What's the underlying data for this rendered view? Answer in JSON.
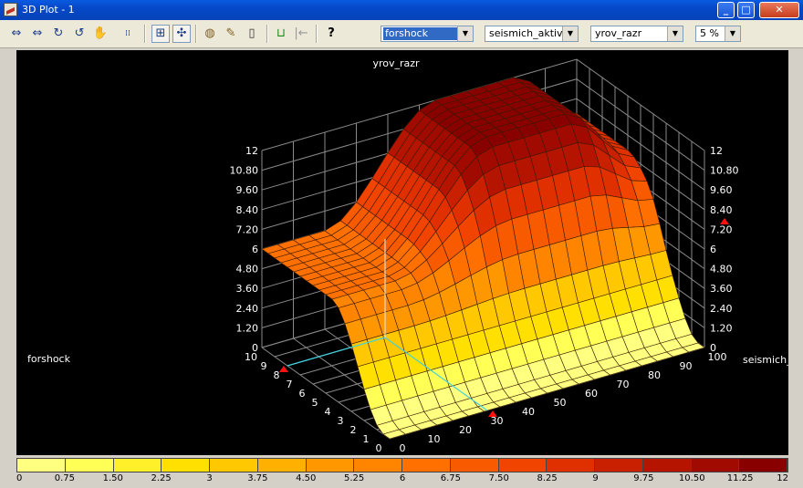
{
  "window": {
    "title": "3D Plot - 1",
    "min": "_",
    "max": "□",
    "close": "✕"
  },
  "toolbar": {
    "combo_x": "forshock",
    "combo_y": "seismich_aktivn",
    "combo_z": "yrov_razr",
    "combo_pct": "5 %"
  },
  "plot": {
    "z_title": "yrov_razr",
    "x_axis_label": "forshock",
    "y_axis_label": "seismich_a",
    "z_ticks": [
      "0",
      "1.20",
      "2.40",
      "3.60",
      "4.80",
      "6",
      "7.20",
      "8.40",
      "9.60",
      "10.80",
      "12"
    ],
    "x_ticks": [
      "0",
      "1",
      "2",
      "3",
      "4",
      "5",
      "6",
      "7",
      "8",
      "9",
      "10"
    ],
    "y_ticks": [
      "0",
      "10",
      "20",
      "30",
      "40",
      "50",
      "60",
      "70",
      "80",
      "90",
      "100"
    ]
  },
  "colors": [
    "#ffff80",
    "#ffff55",
    "#fff02a",
    "#ffe000",
    "#ffc800",
    "#ffb000",
    "#ff9800",
    "#ff8400",
    "#ff7000",
    "#f85a00",
    "#f04400",
    "#e03000",
    "#c82000",
    "#b41400",
    "#a00a00",
    "#880000"
  ],
  "legend": [
    "0",
    "0.75",
    "1.50",
    "2.25",
    "3",
    "3.75",
    "4.50",
    "5.25",
    "6",
    "6.75",
    "7.50",
    "8.25",
    "9",
    "9.75",
    "10.50",
    "11.25",
    "12"
  ],
  "chart_data": {
    "type": "surface",
    "xlabel": "forshock",
    "ylabel": "seismich_a",
    "zlabel": "yrov_razr",
    "xlim": [
      0,
      10
    ],
    "ylim": [
      0,
      100
    ],
    "zlim": [
      0,
      12
    ]
  }
}
